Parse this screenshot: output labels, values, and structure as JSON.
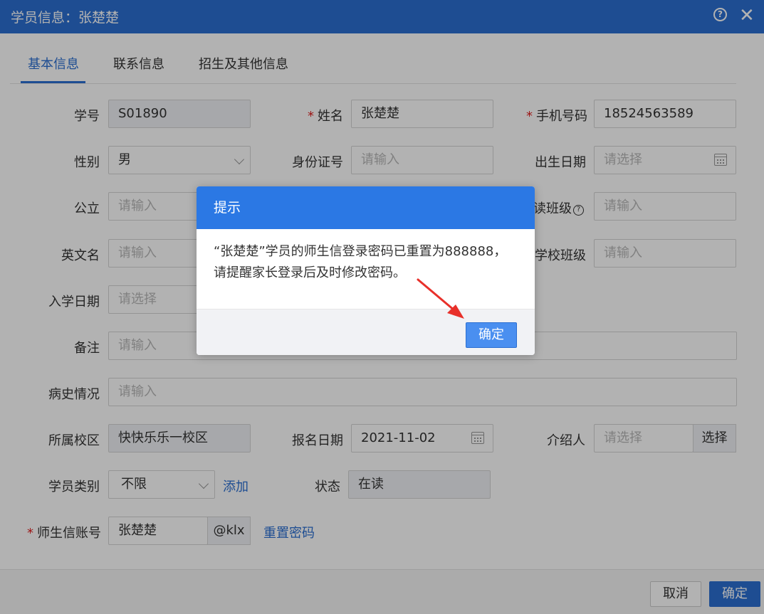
{
  "window": {
    "title": "学员信息：张楚楚",
    "help_icon": "question-circle-icon",
    "close_icon": "close-icon",
    "help_glyph": "?",
    "close_glyph": "✕"
  },
  "tabs": [
    {
      "label": "基本信息",
      "active": true
    },
    {
      "label": "联系信息",
      "active": false
    },
    {
      "label": "招生及其他信息",
      "active": false
    }
  ],
  "form": {
    "student_no": {
      "label": "学号",
      "value": "S01890"
    },
    "name": {
      "label": "姓名",
      "required": "*",
      "value": "张楚楚"
    },
    "phone": {
      "label": "手机号码",
      "required": "*",
      "value": "18524563589"
    },
    "gender": {
      "label": "性别",
      "value": "男"
    },
    "id_card": {
      "label": "身份证号",
      "placeholder": "请输入"
    },
    "birth_date": {
      "label": "出生日期",
      "placeholder": "请选择"
    },
    "school": {
      "label": "公立",
      "placeholder": "请输入"
    },
    "reading_class": {
      "label": "读班级",
      "placeholder": "请输入",
      "help": "?"
    },
    "english_name": {
      "label": "英文名",
      "placeholder": "请输入"
    },
    "school_class": {
      "label": "学校班级",
      "placeholder": "请输入"
    },
    "enroll_date": {
      "label": "入学日期",
      "placeholder": "请选择"
    },
    "remark": {
      "label": "备注",
      "placeholder": "请输入"
    },
    "medical_history": {
      "label": "病史情况",
      "placeholder": "请输入"
    },
    "campus": {
      "label": "所属校区",
      "value": "快快乐乐一校区"
    },
    "signup_date": {
      "label": "报名日期",
      "value": "2021-11-02"
    },
    "referrer": {
      "label": "介绍人",
      "placeholder": "请选择",
      "button": "选择"
    },
    "student_type": {
      "label": "学员类别",
      "value": "不限",
      "add_link": "添加"
    },
    "status": {
      "label": "状态",
      "value": "在读"
    },
    "account": {
      "label": "师生信账号",
      "required": "*",
      "value": "张楚楚",
      "suffix": "@klx",
      "reset_link": "重置密码"
    }
  },
  "footer": {
    "cancel_label": "取消",
    "ok_label": "确定"
  },
  "dialog": {
    "title": "提示",
    "message_line1": "“张楚楚”学员的师生信登录密码已重置为888888，",
    "message_line2": "请提醒家长登录后及时修改密码。",
    "ok_label": "确定"
  },
  "colors": {
    "primary": "#2b6fd1",
    "dialog_header": "#2b78e4",
    "required": "#e02020",
    "annotation_arrow": "#e8302a"
  }
}
